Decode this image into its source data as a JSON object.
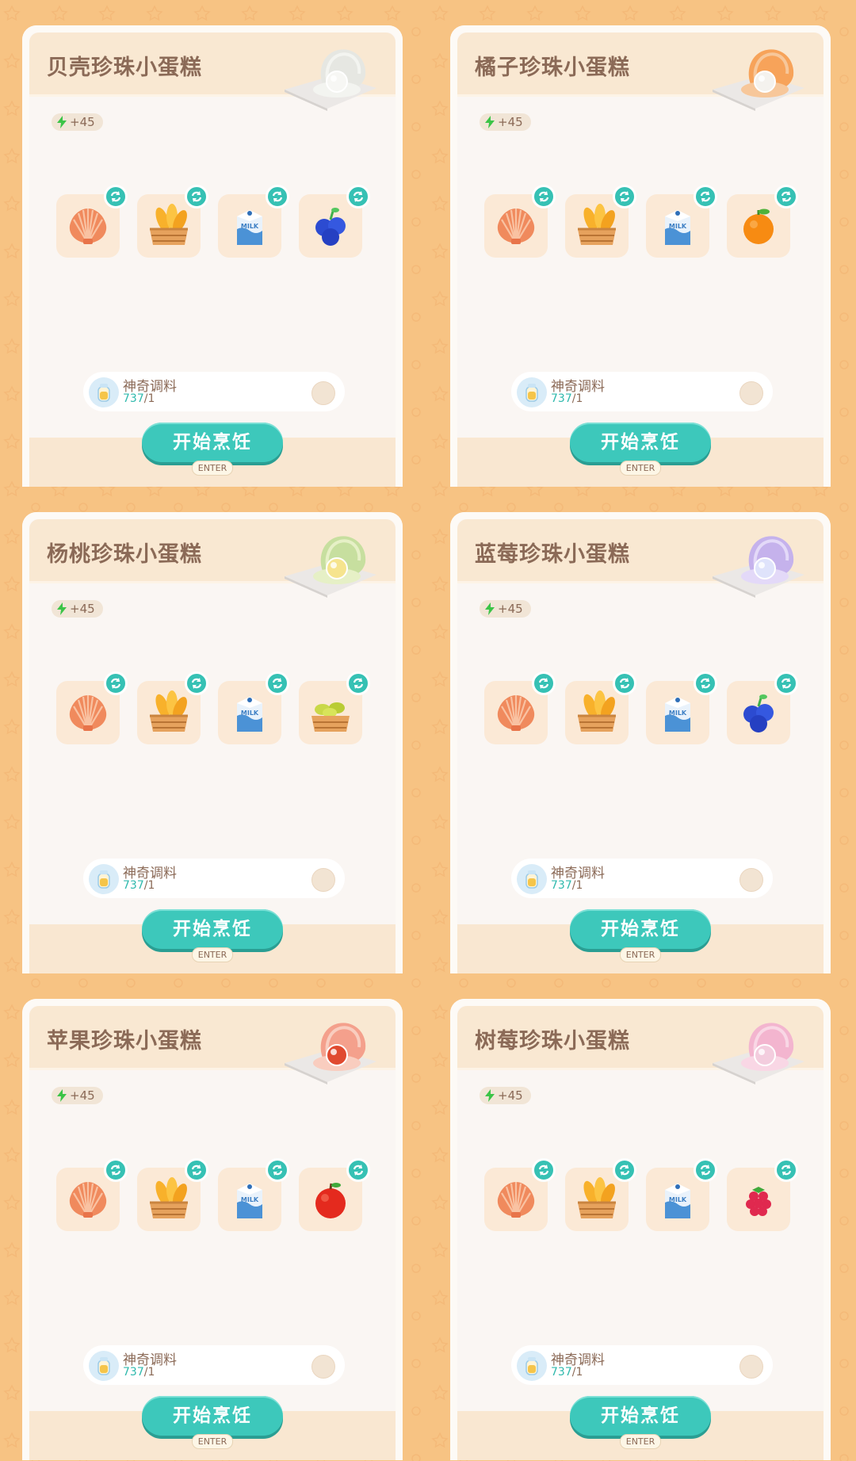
{
  "energy_label": "+45",
  "cook_label": "开始烹饪",
  "enter_label": "ENTER",
  "seasoning": {
    "name": "神奇调料",
    "count": "737",
    "required": "/1"
  },
  "colors": {
    "accent": "#3dc8bb",
    "background": "#f7c383",
    "title": "#8b6a57"
  },
  "recipes": [
    {
      "title": "贝壳珍珠小蛋糕",
      "dish_icon": "white-pearl-shell-icon",
      "ingredients": [
        "scallop-shell-icon",
        "mango-crate-icon",
        "milk-carton-icon",
        "blueberry-icon"
      ]
    },
    {
      "title": "橘子珍珠小蛋糕",
      "dish_icon": "orange-pearl-shell-icon",
      "ingredients": [
        "scallop-shell-icon",
        "mango-crate-icon",
        "milk-carton-icon",
        "orange-icon"
      ]
    },
    {
      "title": "杨桃珍珠小蛋糕",
      "dish_icon": "starfruit-pearl-shell-icon",
      "ingredients": [
        "scallop-shell-icon",
        "mango-crate-icon",
        "milk-carton-icon",
        "starfruit-crate-icon"
      ]
    },
    {
      "title": "蓝莓珍珠小蛋糕",
      "dish_icon": "blueberry-pearl-shell-icon",
      "ingredients": [
        "scallop-shell-icon",
        "mango-crate-icon",
        "milk-carton-icon",
        "blueberry-icon"
      ]
    },
    {
      "title": "苹果珍珠小蛋糕",
      "dish_icon": "apple-pearl-shell-icon",
      "ingredients": [
        "scallop-shell-icon",
        "mango-crate-icon",
        "milk-carton-icon",
        "apple-icon"
      ]
    },
    {
      "title": "树莓珍珠小蛋糕",
      "dish_icon": "raspberry-pearl-shell-icon",
      "ingredients": [
        "scallop-shell-icon",
        "mango-crate-icon",
        "milk-carton-icon",
        "raspberry-icon"
      ]
    }
  ]
}
